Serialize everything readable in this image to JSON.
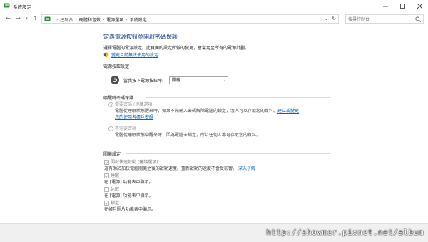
{
  "window": {
    "title": "系統設定",
    "buttons": {
      "minimize": "minimize",
      "maximize": "maximize",
      "close": "close"
    }
  },
  "nav": {
    "breadcrumbs": [
      "控制台",
      "硬體和音效",
      "電源選項",
      "系統設定"
    ],
    "search_placeholder": "搜尋控制台"
  },
  "page": {
    "title": "定義電源按鈕並開啟密碼保護",
    "description": "選擇電腦的電源設定。此頁面的設定所做的變更，會套用至所有的電源計劃。",
    "admin_link": "變更目前無法使用的設定"
  },
  "power_button": {
    "section": "電源按鈕設定",
    "label": "當我按下電源按鈕時:",
    "selected": "關機"
  },
  "wake_password": {
    "section": "喚醒時密碼保護",
    "options": [
      {
        "label": "需要密碼 (建議選項)",
        "checked": true,
        "desc1": "電腦從睡眠狀態醒來時，如果不先輸入密碼解除電腦的鎖定，沒人可以存取您的資料。",
        "link1": "建立或變更",
        "link2": "您的使用者帳戶密碼"
      },
      {
        "label": "不需要密碼",
        "checked": false,
        "desc1": "電腦從睡眠狀態中醒來時，因為電腦未鎖定，所以任何人都可存取您的資料。"
      }
    ]
  },
  "shutdown": {
    "section": "關機設定",
    "items": [
      {
        "label": "開啟快速啟動 (建議選項)",
        "checked": true,
        "desc": "這有助於加快電腦關機之後的啟動速度。重新啟動的速度不會受影響。",
        "link": "深入了解"
      },
      {
        "label": "睡眠",
        "checked": true,
        "desc": "在 [電源] 功能表中顯示。"
      },
      {
        "label": "休眠",
        "checked": false,
        "desc": "在 [電源] 功能表中顯示。"
      },
      {
        "label": "鎖定",
        "checked": true,
        "desc": "在帳戶圖片功能表中顯示。"
      }
    ]
  },
  "watermark": "http://showmer.pixnet.net/album",
  "colors": {
    "title_blue": "#1a3c8c",
    "link_blue": "#0066cc"
  }
}
